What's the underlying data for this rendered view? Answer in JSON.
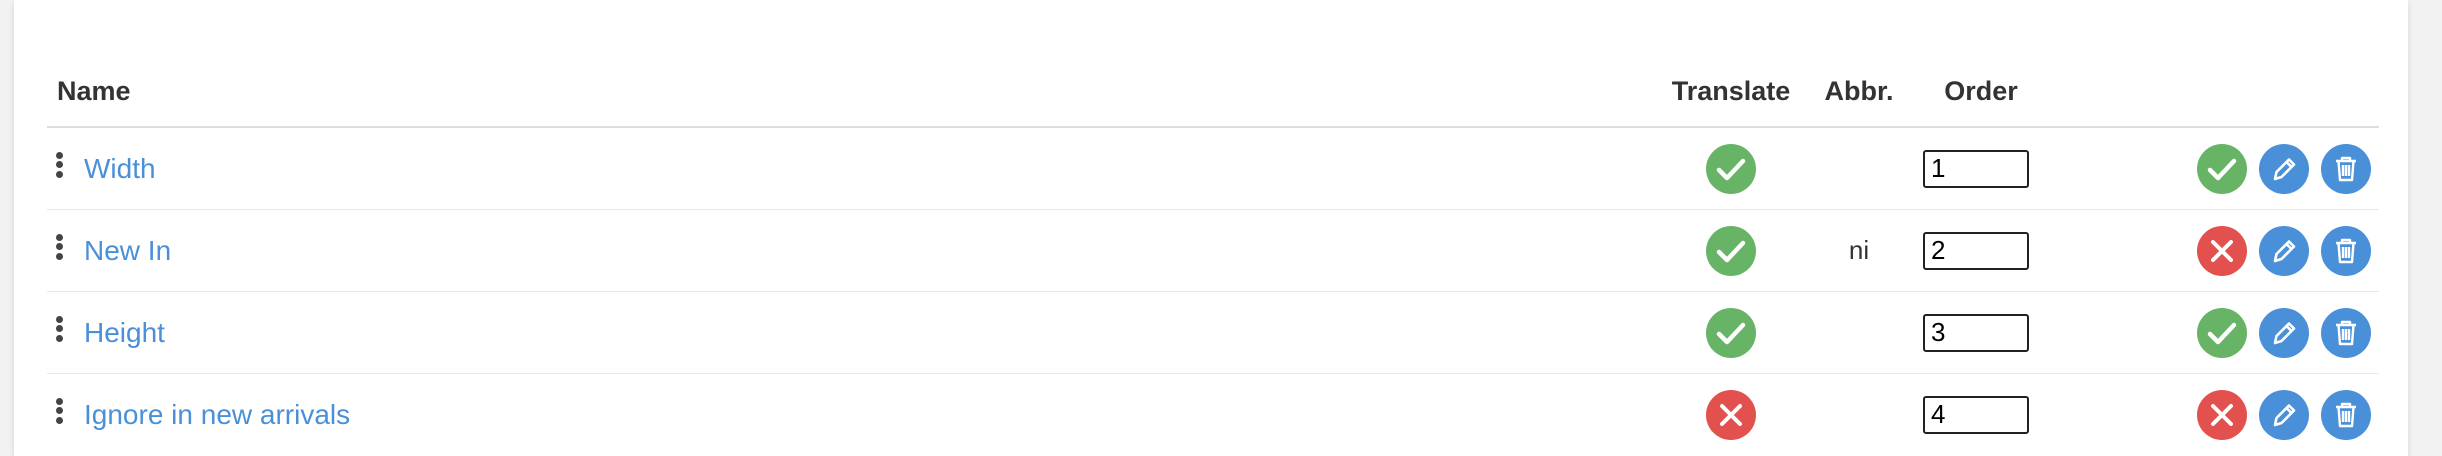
{
  "colors": {
    "green": "#68b466",
    "red": "#e2514e",
    "blue": "#4a90d9",
    "link": "#4a90d9"
  },
  "table": {
    "headers": {
      "name": "Name",
      "translate": "Translate",
      "abbr": "Abbr.",
      "order": "Order"
    },
    "rows": [
      {
        "name": "Width",
        "translate": "check-icon",
        "abbr": "",
        "order": "1",
        "status": "check-icon"
      },
      {
        "name": "New In",
        "translate": "check-icon",
        "abbr": "ni",
        "order": "2",
        "status": "close-icon"
      },
      {
        "name": "Height",
        "translate": "check-icon",
        "abbr": "",
        "order": "3",
        "status": "check-icon"
      },
      {
        "name": "Ignore in new arrivals",
        "translate": "close-icon",
        "abbr": "",
        "order": "4",
        "status": "close-icon"
      }
    ]
  },
  "icons": {
    "drag": "drag-handle-icon",
    "edit": "pencil-icon",
    "delete": "trash-icon"
  }
}
